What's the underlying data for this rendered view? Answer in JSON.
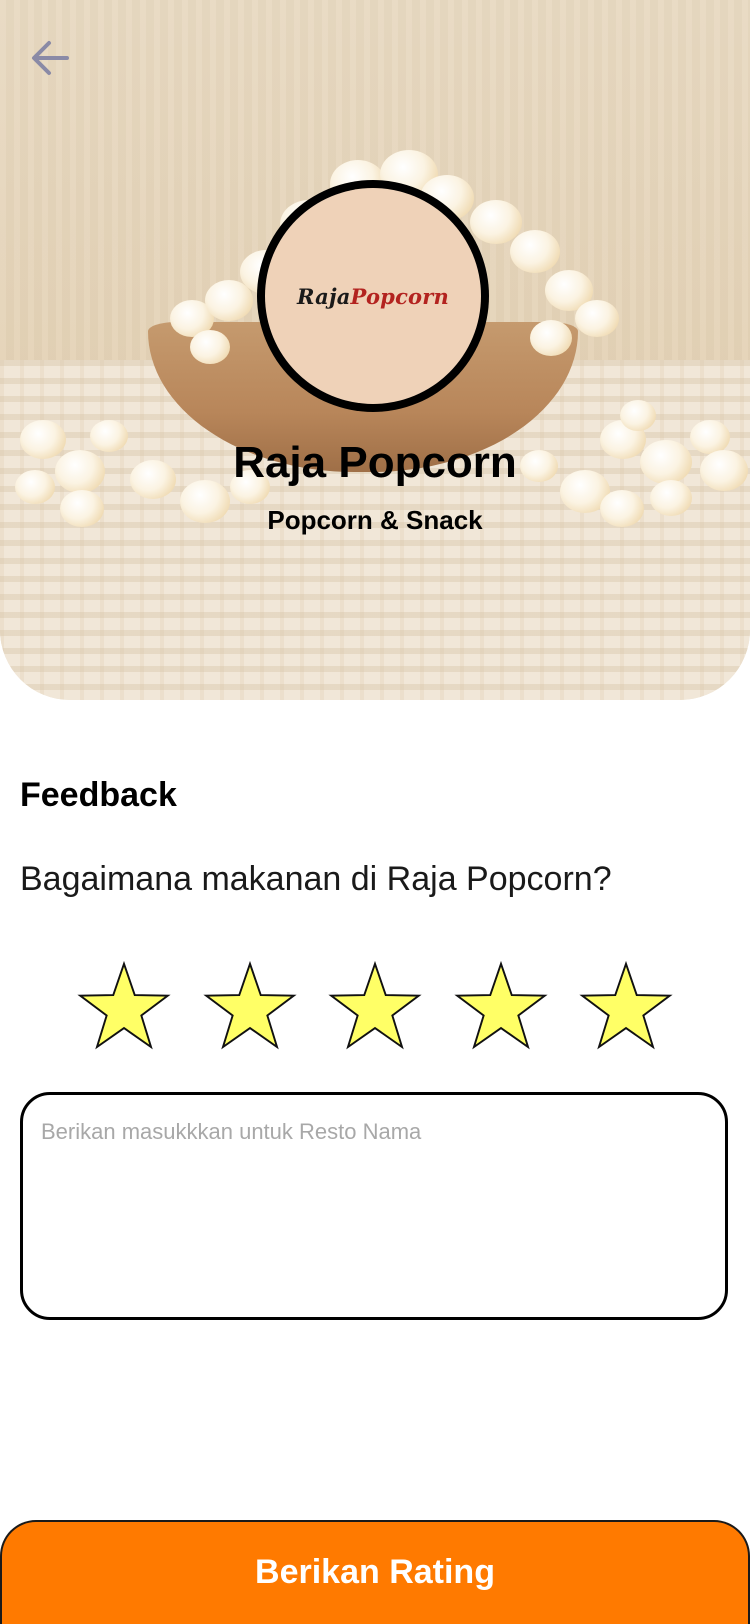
{
  "header": {
    "back_icon": "arrow-left-icon",
    "restaurant_name": "Raja Popcorn",
    "restaurant_category": "Popcorn & Snack",
    "logo": {
      "part1": "Raja",
      "part2": "Popcorn"
    }
  },
  "feedback": {
    "title": "Feedback",
    "question": "Bagaimana makanan di Raja Popcorn?",
    "rating_max": 5,
    "star_icon": "star-icon",
    "input_placeholder": "Berikan masukkkan untuk Resto Nama",
    "input_value": ""
  },
  "footer": {
    "submit_label": "Berikan Rating"
  },
  "colors": {
    "accent": "#ff7a00",
    "star_fill": "#ffff66",
    "logo_bg": "#efd2b8",
    "logo_red": "#b3231f"
  }
}
